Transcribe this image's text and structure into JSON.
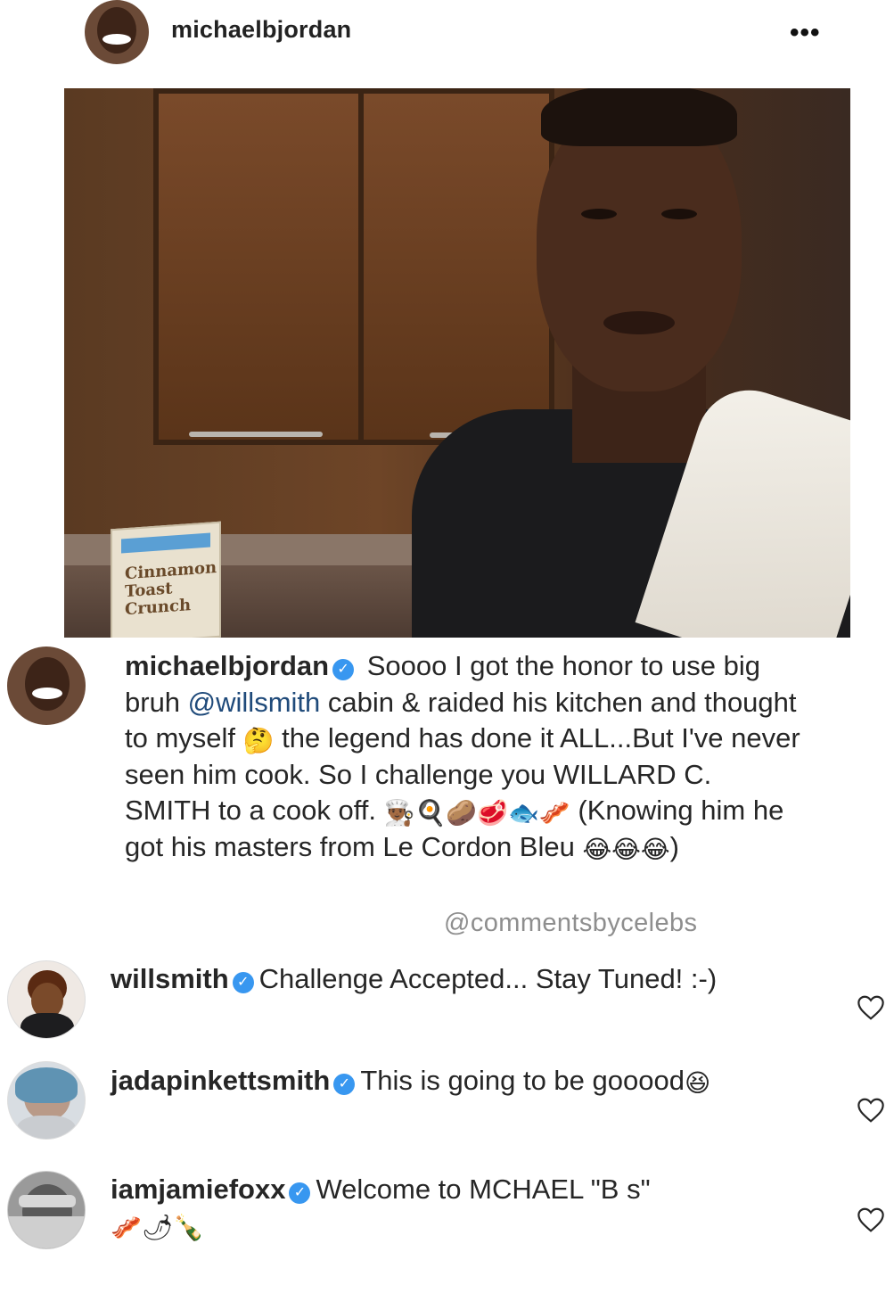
{
  "post": {
    "username": "michaelbjordan",
    "more_icon": "more-dots-icon",
    "more_label": "•••"
  },
  "photo": {
    "cereal_label": "Cinnamon Toast Crunch"
  },
  "caption": {
    "username": "michaelbjordan",
    "text_1": " Soooo I got the honor to use big bruh ",
    "mention": "@willsmith",
    "text_2": " cabin & raided his kitchen and thought to myself ",
    "emoji_think": "🤔",
    "text_3": " the legend has done it ALL...But I've never seen him cook. So I challenge you WILLARD C. SMITH to a cook off. ",
    "emoji_list": "👨🏾‍🍳🍳🥔🥩🐟🥓",
    "text_4": " (Knowing him he got his masters from Le Cordon Bleu ",
    "emoji_laugh": "😂😂😂",
    "text_5": ")"
  },
  "watermark": "@commentsbycelebs",
  "comments": [
    {
      "username": "willsmith",
      "text": "Challenge Accepted... Stay Tuned! :-)",
      "emoji": ""
    },
    {
      "username": "jadapinkettsmith",
      "text": "This is going to be gooood",
      "emoji": "😆"
    },
    {
      "username": "iamjamiefoxx",
      "text": "Welcome to MCHAEL \"B s\" ",
      "emoji": "🥓🌶🍾"
    }
  ],
  "colors": {
    "verified": "#3897f0",
    "mention": "#1f4a7a",
    "muted": "#8e8e8e"
  }
}
